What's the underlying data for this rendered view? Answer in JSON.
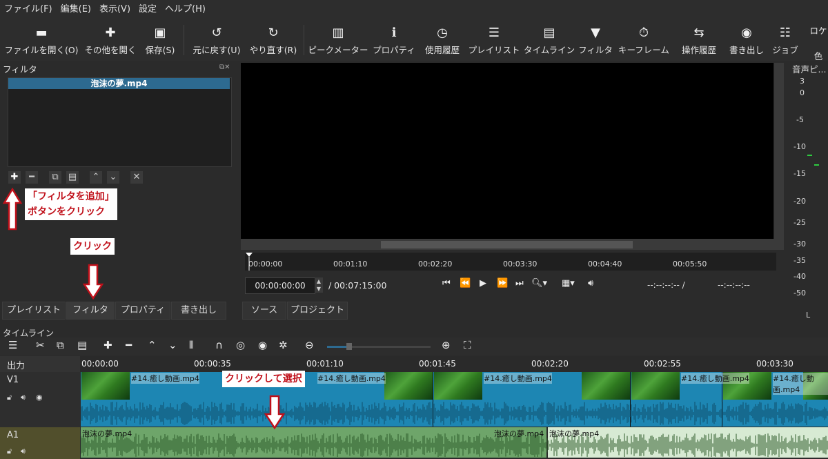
{
  "menu": [
    "ファイル(F)",
    "編集(E)",
    "表示(V)",
    "設定",
    "ヘルプ(H)"
  ],
  "toolbar": {
    "buttons": [
      {
        "label": "ファイルを開く(O)",
        "icon": "folder-open-icon",
        "glyph": "▬"
      },
      {
        "label": "その他を開く",
        "icon": "open-other-icon",
        "glyph": "✚"
      },
      {
        "label": "保存(S)",
        "icon": "save-icon",
        "glyph": "▣"
      },
      {
        "label": "元に戻す(U)",
        "icon": "undo-icon",
        "glyph": "↺"
      },
      {
        "label": "やり直す(R)",
        "icon": "redo-icon",
        "glyph": "↻"
      },
      {
        "label": "ピークメーター",
        "icon": "peak-meter-icon",
        "glyph": "▥"
      },
      {
        "label": "プロパティ",
        "icon": "info-icon",
        "glyph": "ℹ"
      },
      {
        "label": "使用履歴",
        "icon": "clock-icon",
        "glyph": "◷"
      },
      {
        "label": "プレイリスト",
        "icon": "list-icon",
        "glyph": "☰"
      },
      {
        "label": "タイムライン",
        "icon": "timeline-icon",
        "glyph": "▤"
      },
      {
        "label": "フィルタ",
        "icon": "filter-icon",
        "glyph": "▼"
      },
      {
        "label": "キーフレーム",
        "icon": "stopwatch-icon",
        "glyph": "⏱"
      },
      {
        "label": "操作履歴",
        "icon": "history-icon",
        "glyph": "⇆"
      },
      {
        "label": "書き出し",
        "icon": "disc-icon",
        "glyph": "◉"
      },
      {
        "label": "ジョブ",
        "icon": "database-icon",
        "glyph": "☷"
      },
      {
        "label": "ロケ",
        "icon": "color-icon",
        "glyph": ""
      }
    ],
    "last_label_suffix": "色"
  },
  "filter_panel": {
    "title": "フィルタ",
    "selected_item": "泡沫の夢.mp4"
  },
  "annotations": {
    "add_filter_line1": "「フィルタを追加」",
    "add_filter_line2": "ボタンをクリック",
    "click": "クリック",
    "click_select": "クリックして選択"
  },
  "left_tabs": [
    "プレイリスト",
    "フィルタ",
    "プロパティ",
    "書き出し"
  ],
  "viewer_tabs": [
    "ソース",
    "プロジェクト"
  ],
  "viewer": {
    "ruler_ticks": [
      "00:00:00",
      "00:01:10",
      "00:02:20",
      "00:03:30",
      "00:04:40",
      "00:05:50"
    ],
    "timecode": "00:00:00:00",
    "duration": "/ 00:07:15:00",
    "in_point": "--:--:--:-- /",
    "out_point": "--:--:--:--"
  },
  "audio_meter": {
    "title": "音声ピ...",
    "labels": [
      "3",
      "0",
      "-5",
      "-10",
      "-15",
      "-20",
      "-25",
      "-30",
      "-35",
      "-40",
      "-50",
      "L"
    ]
  },
  "timeline": {
    "title": "タイムライン",
    "output_label": "出力",
    "ticks": [
      "00:00:00",
      "00:00:35",
      "00:01:10",
      "00:01:45",
      "00:02:20",
      "00:02:55",
      "00:03:30"
    ],
    "tracks": {
      "video": "V1",
      "audio": "A1"
    },
    "video_clip_label": "#14.癒し動画.mp4",
    "audio_clip_label": "泡沫の夢.mp4"
  },
  "colors": {
    "accent": "#2d6a90",
    "annotation_red": "#c0101a",
    "clip_blue": "#1d86b3",
    "audio_green": "#6ea56a"
  }
}
